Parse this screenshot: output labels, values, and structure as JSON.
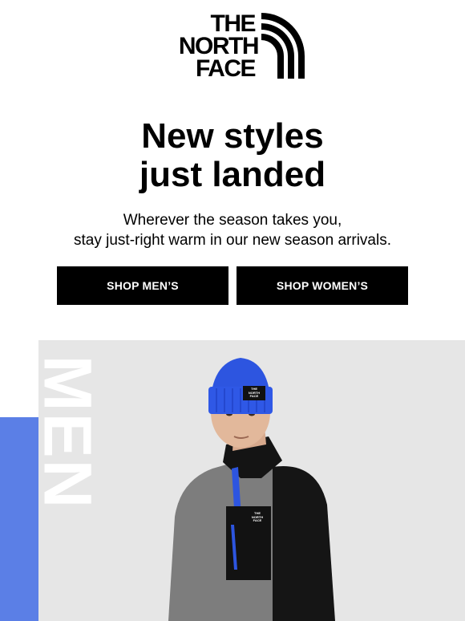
{
  "brand": {
    "logo_lines": [
      "THE",
      "NORTH",
      "FACE"
    ]
  },
  "headline": {
    "line1": "New styles",
    "line2": "just landed"
  },
  "subtext": {
    "line1": "Wherever the season takes you,",
    "line2": "stay just-right warm in our new season arrivals."
  },
  "buttons": {
    "men": "SHOP MEN’S",
    "women": "SHOP WOMEN’S"
  },
  "hero": {
    "vertical_label": "MEN",
    "beanie_patch": [
      "THE",
      "NORTH",
      "FACE"
    ],
    "chest_patch": [
      "THE",
      "NORTH",
      "FACE"
    ]
  },
  "colors": {
    "accent_blue": "#5b7fe6",
    "beanie_blue": "#2d55e0",
    "button_bg": "#000000",
    "hero_bg": "#e6e6e6"
  },
  "icons": {
    "logo_mark": "half-dome-icon"
  }
}
